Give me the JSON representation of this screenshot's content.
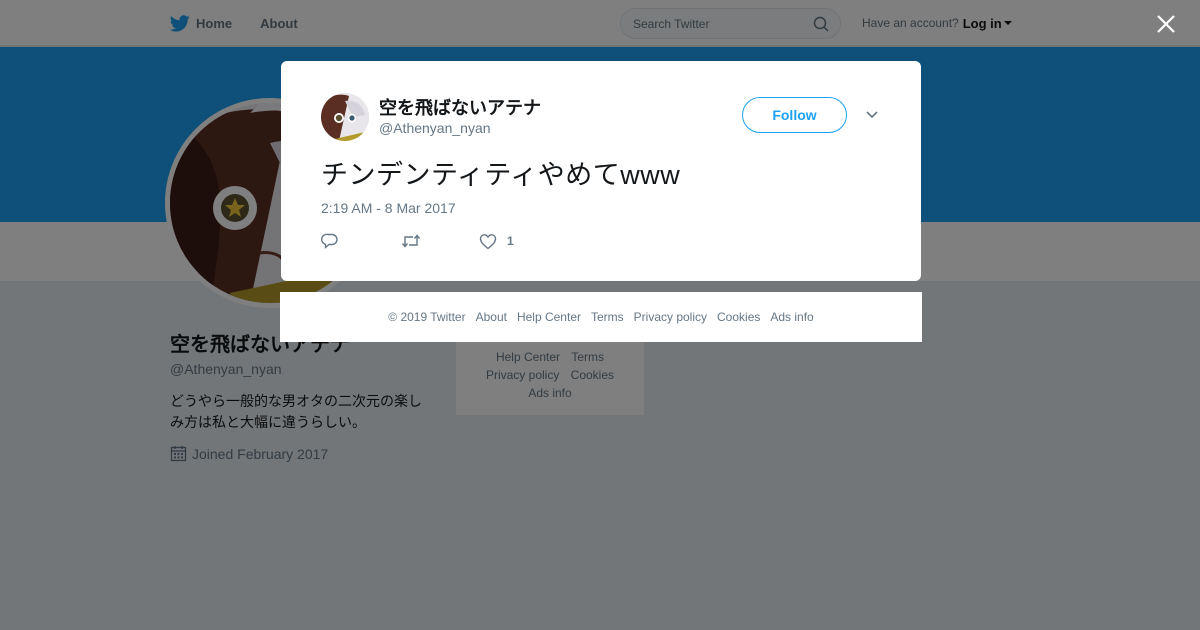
{
  "nav": {
    "home_label": "Home",
    "about_label": "About",
    "search_placeholder": "Search Twitter",
    "have_account": "Have an account?",
    "login_label": "Log in"
  },
  "colors": {
    "brand_blue": "#1da1f2",
    "text_secondary": "#657786",
    "overlay": "rgba(0,0,0,0.5)"
  },
  "profile": {
    "name": "空を飛ばないアテナ",
    "handle": "@Athenyan_nyan",
    "bio": "どうやら一般的な男オタの二次元の楽しみ方は私と大幅に違うらしい。",
    "joined": "Joined February 2017"
  },
  "side_footer": {
    "help_center": "Help Center",
    "terms": "Terms",
    "privacy": "Privacy policy",
    "cookies": "Cookies",
    "ads_info": "Ads info"
  },
  "tweet": {
    "name": "空を飛ばないアテナ",
    "handle": "@Athenyan_nyan",
    "follow_label": "Follow",
    "text": "チンデンティティやめてwww",
    "timestamp": "2:19 AM - 8 Mar 2017",
    "like_count": "1"
  },
  "footer": {
    "copyright": "© 2019 Twitter",
    "about": "About",
    "help_center": "Help Center",
    "terms": "Terms",
    "privacy": "Privacy policy",
    "cookies": "Cookies",
    "ads_info": "Ads info"
  }
}
